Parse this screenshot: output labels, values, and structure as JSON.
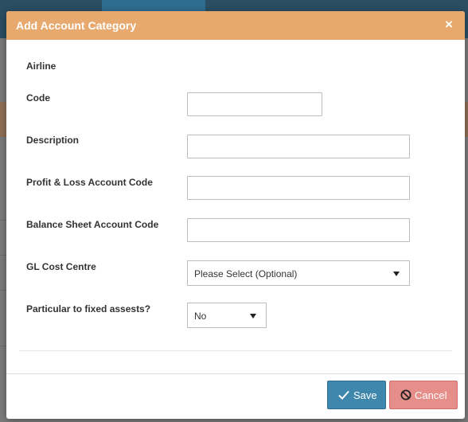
{
  "modal": {
    "title": "Add Account Category",
    "close_glyph": "×"
  },
  "form": {
    "airline_label": "Airline",
    "code_label": "Code",
    "code_value": "",
    "description_label": "Description",
    "description_value": "",
    "pl_label": "Profit & Loss Account Code",
    "pl_value": "",
    "bs_label": "Balance Sheet Account Code",
    "bs_value": "",
    "cost_centre_label": "GL Cost Centre",
    "cost_centre_value": "Please Select (Optional)",
    "fixed_assets_label": "Particular to fixed assests?",
    "fixed_assets_value": "No"
  },
  "footer": {
    "save_label": "Save",
    "cancel_label": "Cancel"
  },
  "colors": {
    "header_bg": "#e8a96e",
    "save_bg": "#3f87ad",
    "cancel_bg": "#e58e8a"
  },
  "icons": {
    "close": "close-icon",
    "save": "check-icon",
    "cancel": "ban-icon",
    "dropdown": "caret-down-icon"
  }
}
